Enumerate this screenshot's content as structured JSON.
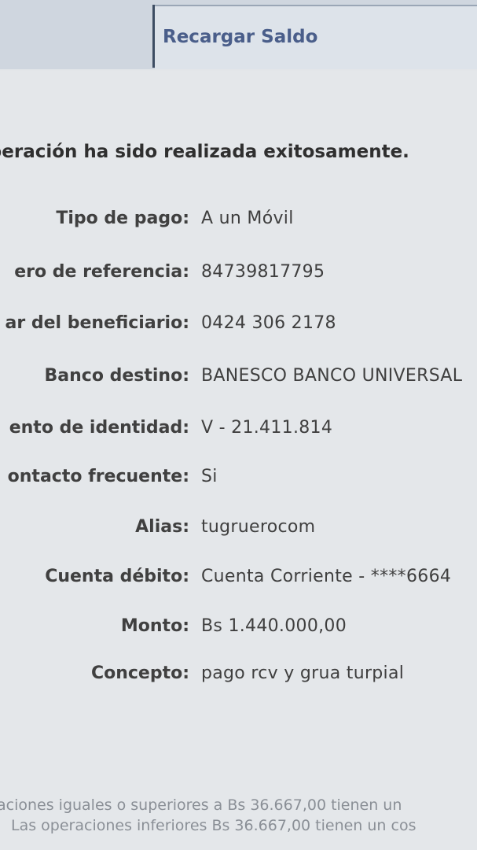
{
  "header": {
    "tab_label": "Recargar Saldo"
  },
  "message": {
    "success": "operación ha sido realizada exitosamente."
  },
  "details": [
    {
      "label": "Tipo de pago:",
      "value": "A un Móvil"
    },
    {
      "label": "ero de referencia:",
      "value": "84739817795"
    },
    {
      "label": "ar del beneficiario:",
      "value": "0424 306 2178"
    },
    {
      "label": "Banco destino:",
      "value": "BANESCO BANCO UNIVERSAL"
    },
    {
      "label": "ento de identidad:",
      "value": "V - 21.411.814"
    },
    {
      "label": "ontacto frecuente:",
      "value": "Si"
    },
    {
      "label": "Alias:",
      "value": "tugruerocom"
    },
    {
      "label": "Cuenta débito:",
      "value": "Cuenta Corriente - ****6664"
    },
    {
      "label": "Monto:",
      "value": "Bs 1.440.000,00"
    },
    {
      "label": "Concepto:",
      "value": "pago rcv y grua turpial"
    }
  ],
  "footer": {
    "line1": "aciones iguales o superiores a Bs 36.667,00 tienen un",
    "line2": "Las operaciones inferiores Bs 36.667,00 tienen un cos"
  }
}
